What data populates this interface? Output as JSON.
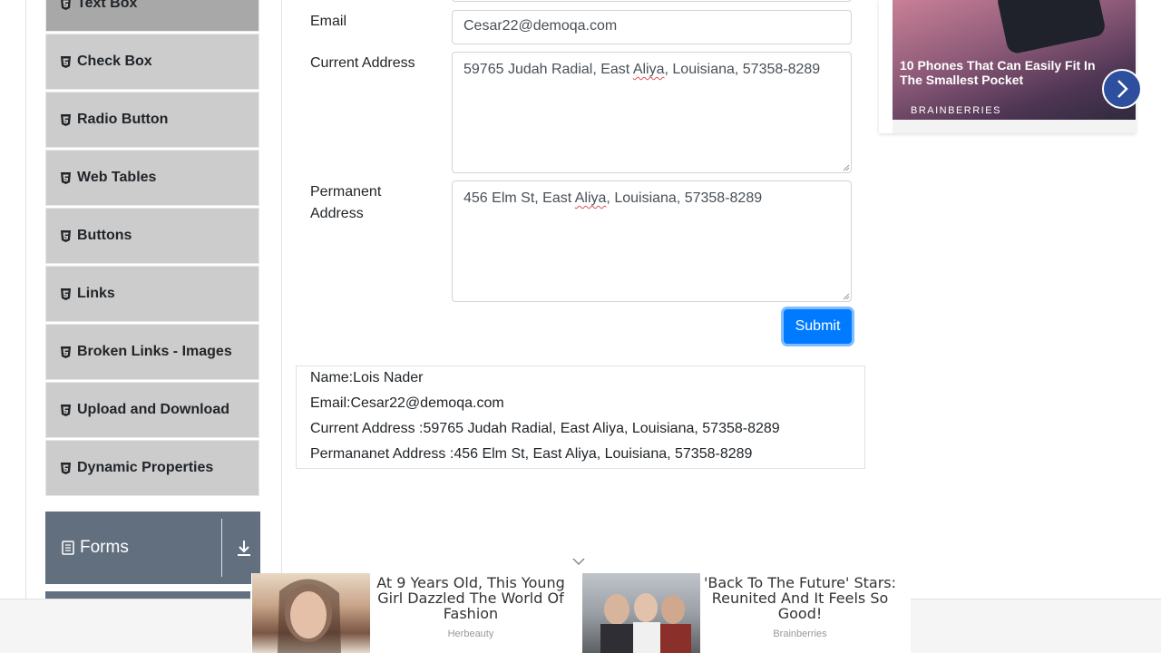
{
  "sidebar": {
    "items": [
      {
        "label": "Text Box",
        "icon": "html5-icon",
        "active": true
      },
      {
        "label": "Check Box",
        "icon": "html5-icon"
      },
      {
        "label": "Radio Button",
        "icon": "html5-icon"
      },
      {
        "label": "Web Tables",
        "icon": "html5-icon"
      },
      {
        "label": "Buttons",
        "icon": "html5-icon"
      },
      {
        "label": "Links",
        "icon": "html5-icon"
      },
      {
        "label": "Broken Links - Images",
        "icon": "html5-icon"
      },
      {
        "label": "Upload and Download",
        "icon": "html5-icon"
      },
      {
        "label": "Dynamic Properties",
        "icon": "html5-icon"
      }
    ],
    "group": {
      "label": "Forms",
      "icon": "document-icon",
      "toggle_icon": "download-arrow-icon"
    }
  },
  "form": {
    "email_label": "Email",
    "email_value": "Cesar22@demoqa.com",
    "current_label": "Current Address",
    "current_value_pre": "59765 Judah Radial, East ",
    "current_value_spell": "Aliya",
    "current_value_post": ", Louisiana, 57358-8289",
    "permanent_label_1": "Permanent",
    "permanent_label_2": "Address",
    "permanent_value_pre": "456 Elm St, East ",
    "permanent_value_spell": "Aliya",
    "permanent_value_post": ", Louisiana, 57358-8289",
    "submit_label": "Submit"
  },
  "output": {
    "name": "Name:Lois Nader",
    "email": "Email:Cesar22@demoqa.com",
    "current": "Current Address :59765 Judah Radial, East Aliya, Louisiana, 57358-8289",
    "permanent": "Permananet Address :456 Elm St, East Aliya, Louisiana, 57358-8289"
  },
  "ad_right": {
    "title": "10 Phones That Can Easily Fit In The Smallest Pocket",
    "source": "BRAINBERRIES",
    "next_icon": "chevron-right-icon"
  },
  "ad_bottom": {
    "collapse_icon": "chevron-down-icon",
    "cards": [
      {
        "title": "At 9 Years Old, This Young Girl Dazzled The World Of Fashion",
        "source": "Herbeauty"
      },
      {
        "title": "'Back To The Future' Stars: Reunited And It Feels So Good!",
        "source": "Brainberries"
      }
    ]
  },
  "colors": {
    "menu_bg": "#cccccc",
    "menu_active_bg": "#a8a8a8",
    "group_bg": "#626f7f",
    "primary": "#007bff"
  }
}
